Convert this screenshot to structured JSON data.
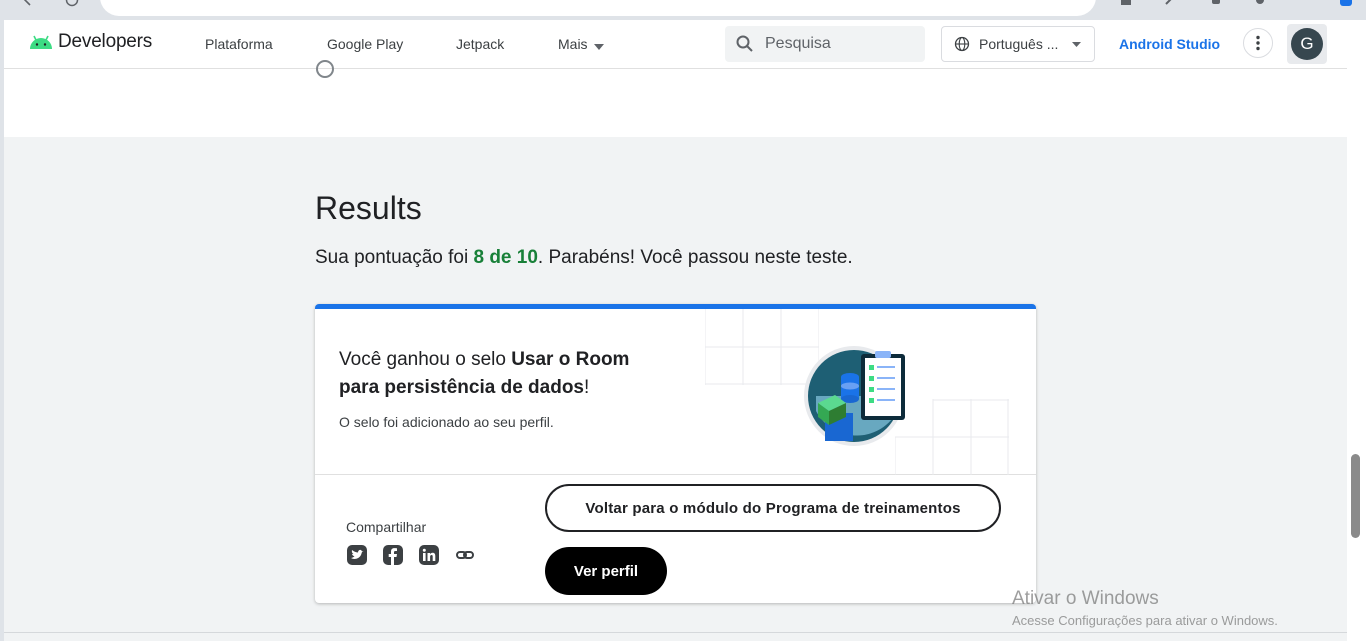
{
  "topbar": {
    "logo_text": "Developers",
    "nav": [
      "Plataforma",
      "Google Play",
      "Jetpack",
      "Mais"
    ],
    "search_placeholder": "Pesquisa",
    "language": "Português ...",
    "studio_link": "Android Studio",
    "avatar_initial": "G"
  },
  "results": {
    "title": "Results",
    "score_prefix": "Sua pontuação foi ",
    "score_value": "8 de 10",
    "score_suffix": ". Parabéns! Você passou neste teste."
  },
  "badge_card": {
    "title_prefix": "Você ganhou o selo ",
    "badge_name": "Usar o Room para persistência de dados",
    "title_suffix": "!",
    "subtitle": "O selo foi adicionado ao seu perfil.",
    "share_label": "Compartilhar",
    "share_icons": [
      "twitter-icon",
      "facebook-icon",
      "linkedin-icon",
      "link-icon"
    ],
    "back_button": "Voltar para o módulo do Programa de treinamentos",
    "profile_button": "Ver perfil"
  },
  "watermark": {
    "line1": "Ativar o Windows",
    "line2": "Acesse Configurações para ativar o Windows."
  },
  "colors": {
    "accent_blue": "#1a73e8",
    "score_green": "#188038",
    "android_green": "#3ddc84"
  }
}
